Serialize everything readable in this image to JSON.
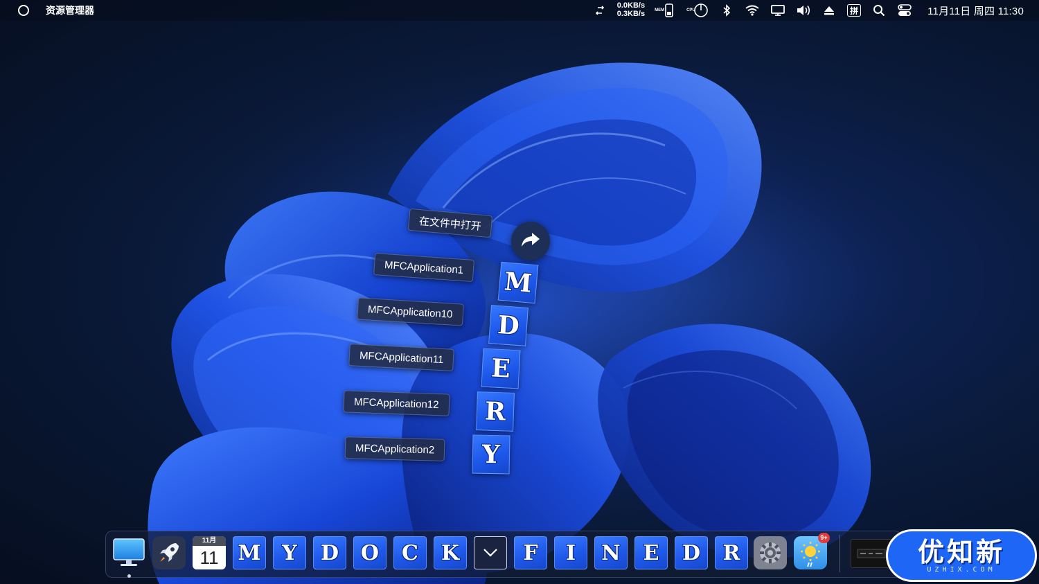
{
  "menubar": {
    "app_title": "资源管理器",
    "net_up": "0.0KB/s",
    "net_down": "0.3KB/s",
    "mem_label": "MEM",
    "cpu_label": "CPU",
    "ime_label": "拼",
    "clock": "11月11日 周四 11:30"
  },
  "stack_menu": {
    "open_in_file": "在文件中打开",
    "items": [
      "MFCApplication1",
      "MFCApplication10",
      "MFCApplication11",
      "MFCApplication12",
      "MFCApplication2"
    ],
    "tiles": [
      "M",
      "D",
      "E",
      "R",
      "Y"
    ]
  },
  "dock": {
    "calendar_month": "11月",
    "calendar_day": "11",
    "letters": [
      "M",
      "Y",
      "D",
      "O",
      "C",
      "K",
      "F",
      "I",
      "N",
      "E",
      "D",
      "R"
    ],
    "weather_badge": "9+"
  },
  "watermark": {
    "title": "优知新",
    "subtitle": "UZHIX.COM"
  },
  "icons": {
    "menu_logo": "circle-logo-icon",
    "sync": "sync-icon",
    "phone": "phone-icon",
    "cpu_gauge": "cpu-gauge-icon",
    "bluetooth": "bluetooth-icon",
    "wifi": "wifi-icon",
    "display": "display-icon",
    "volume": "volume-icon",
    "eject": "eject-icon",
    "search": "search-icon",
    "control_center": "control-center-icon",
    "share": "share-arrow-icon",
    "finder": "finder-monitor-icon",
    "launchpad": "rocket-icon",
    "settings": "gear-icon",
    "weather": "weather-sun-icon",
    "down": "chevron-down-icon"
  },
  "colors": {
    "accent_blue": "#1f58ea",
    "badge_red": "#e23b3b",
    "watermark_blue": "#1e66f5"
  }
}
